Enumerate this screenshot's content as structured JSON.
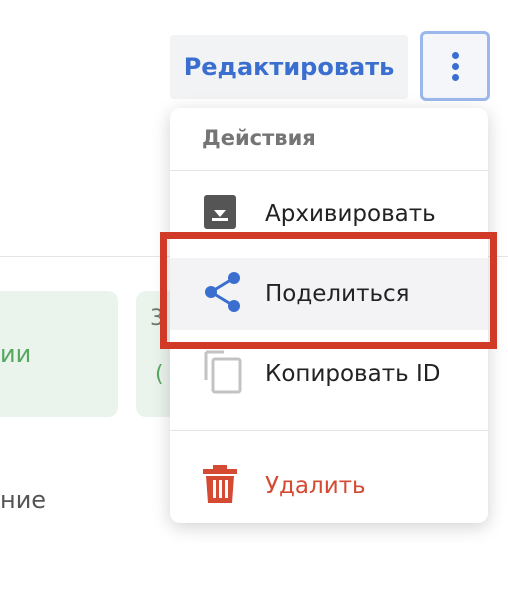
{
  "toolbar": {
    "edit_label": "Редактировать",
    "more_icon": "more-vertical-icon"
  },
  "background": {
    "card_left_text": "ии",
    "card_right_number": "3",
    "card_right_paren": "(",
    "bottom_text": "ние"
  },
  "menu": {
    "header": "Действия",
    "items": [
      {
        "label": "Архивировать",
        "icon": "archive-icon"
      },
      {
        "label": "Поделиться",
        "icon": "share-icon"
      },
      {
        "label": "Копировать ID",
        "icon": "copy-icon"
      },
      {
        "label": "Удалить",
        "icon": "trash-icon"
      }
    ]
  },
  "colors": {
    "accent": "#3a6fd0",
    "danger": "#d44a32",
    "highlight_border": "#d13a26",
    "success_text": "#56a85f"
  }
}
